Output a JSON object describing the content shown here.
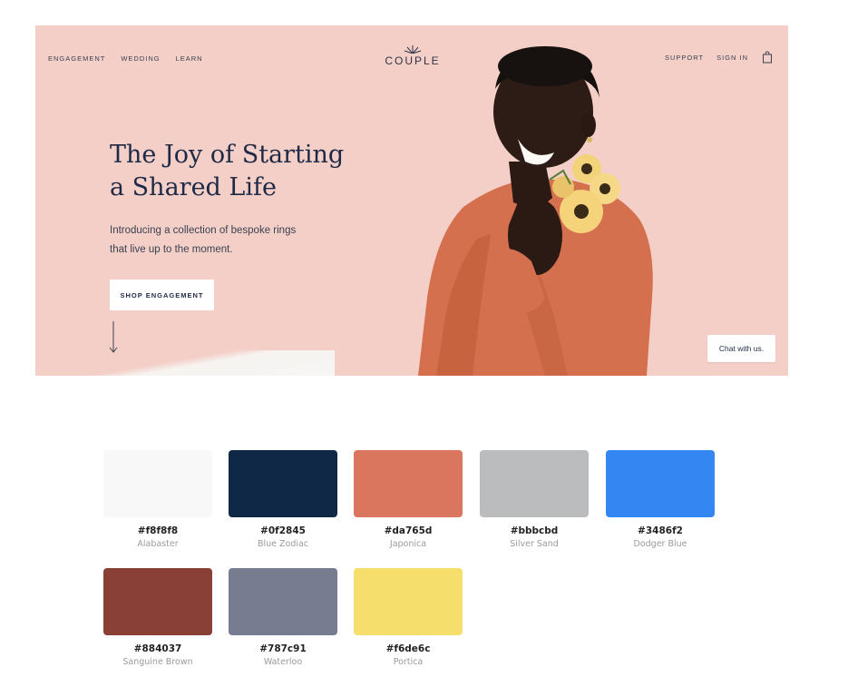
{
  "hero": {
    "nav_left": [
      "ENGAGEMENT",
      "WEDDING",
      "LEARN"
    ],
    "nav_right": [
      "SUPPORT",
      "SIGN IN"
    ],
    "logo": "COUPLE",
    "title_line1": "The Joy of Starting",
    "title_line2": "a Shared Life",
    "subtitle_line1": "Introducing a collection of bespoke rings",
    "subtitle_line2": "that live up to the moment.",
    "cta_label": "SHOP ENGAGEMENT",
    "chat_label": "Chat with us.",
    "icons": [
      "logo-mark-icon",
      "shopping-bag-icon",
      "down-arrow-icon"
    ],
    "background_color": "#f4cfc8"
  },
  "palette": [
    {
      "hex": "#f8f8f8",
      "name": "Alabaster"
    },
    {
      "hex": "#0f2845",
      "name": "Blue Zodiac"
    },
    {
      "hex": "#da765d",
      "name": "Japonica"
    },
    {
      "hex": "#bbbcbd",
      "name": "Silver Sand"
    },
    {
      "hex": "#3486f2",
      "name": "Dodger Blue"
    },
    {
      "hex": "#884037",
      "name": "Sanguine Brown"
    },
    {
      "hex": "#787c91",
      "name": "Waterloo"
    },
    {
      "hex": "#f6de6c",
      "name": "Portica"
    }
  ]
}
